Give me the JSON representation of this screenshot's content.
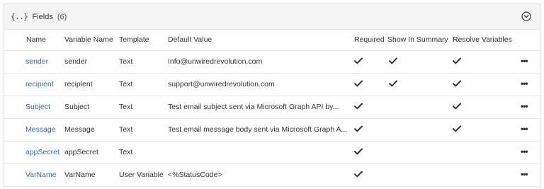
{
  "panel": {
    "icon_text": "{..}",
    "title": "Fields",
    "count": "(6)"
  },
  "columns": {
    "name": "Name",
    "variable_name": "Variable Name",
    "template": "Template",
    "default_value": "Default Value",
    "required": "Required",
    "show_in_summary": "Show In Summary",
    "resolve_variables": "Resolve Variables"
  },
  "rows": [
    {
      "name": "sender",
      "variable_name": "sender",
      "template": "Text",
      "default_value": "Info@unwiredrevolution.com",
      "required": true,
      "show_in_summary": true,
      "resolve_variables": true
    },
    {
      "name": "recipient",
      "variable_name": "recipient",
      "template": "Text",
      "default_value": "support@unwiredrevolution.com",
      "required": true,
      "show_in_summary": true,
      "resolve_variables": true
    },
    {
      "name": "Subject",
      "variable_name": "Subject",
      "template": "Text",
      "default_value": "Test email subject sent via Microsoft Graph API by...",
      "required": true,
      "show_in_summary": false,
      "resolve_variables": true
    },
    {
      "name": "Message",
      "variable_name": "Message",
      "template": "Text",
      "default_value": "Test email message body sent via Microsoft Graph A...",
      "required": true,
      "show_in_summary": false,
      "resolve_variables": true
    },
    {
      "name": "appSecret",
      "variable_name": "appSecret",
      "template": "Text",
      "default_value": "",
      "required": true,
      "show_in_summary": false,
      "resolve_variables": false
    },
    {
      "name": "VarName",
      "variable_name": "VarName",
      "template": "User Variable",
      "default_value": "<%StatusCode>",
      "required": true,
      "show_in_summary": false,
      "resolve_variables": false
    }
  ],
  "icons": {
    "header": "braces-icon",
    "collapse": "chevron-down-circle-icon",
    "check": "check-icon",
    "more": "more-horizontal-icon"
  },
  "colors": {
    "link": "#2a6fb0",
    "header_bg": "#f5f5f5",
    "border": "#e6e6e6"
  }
}
